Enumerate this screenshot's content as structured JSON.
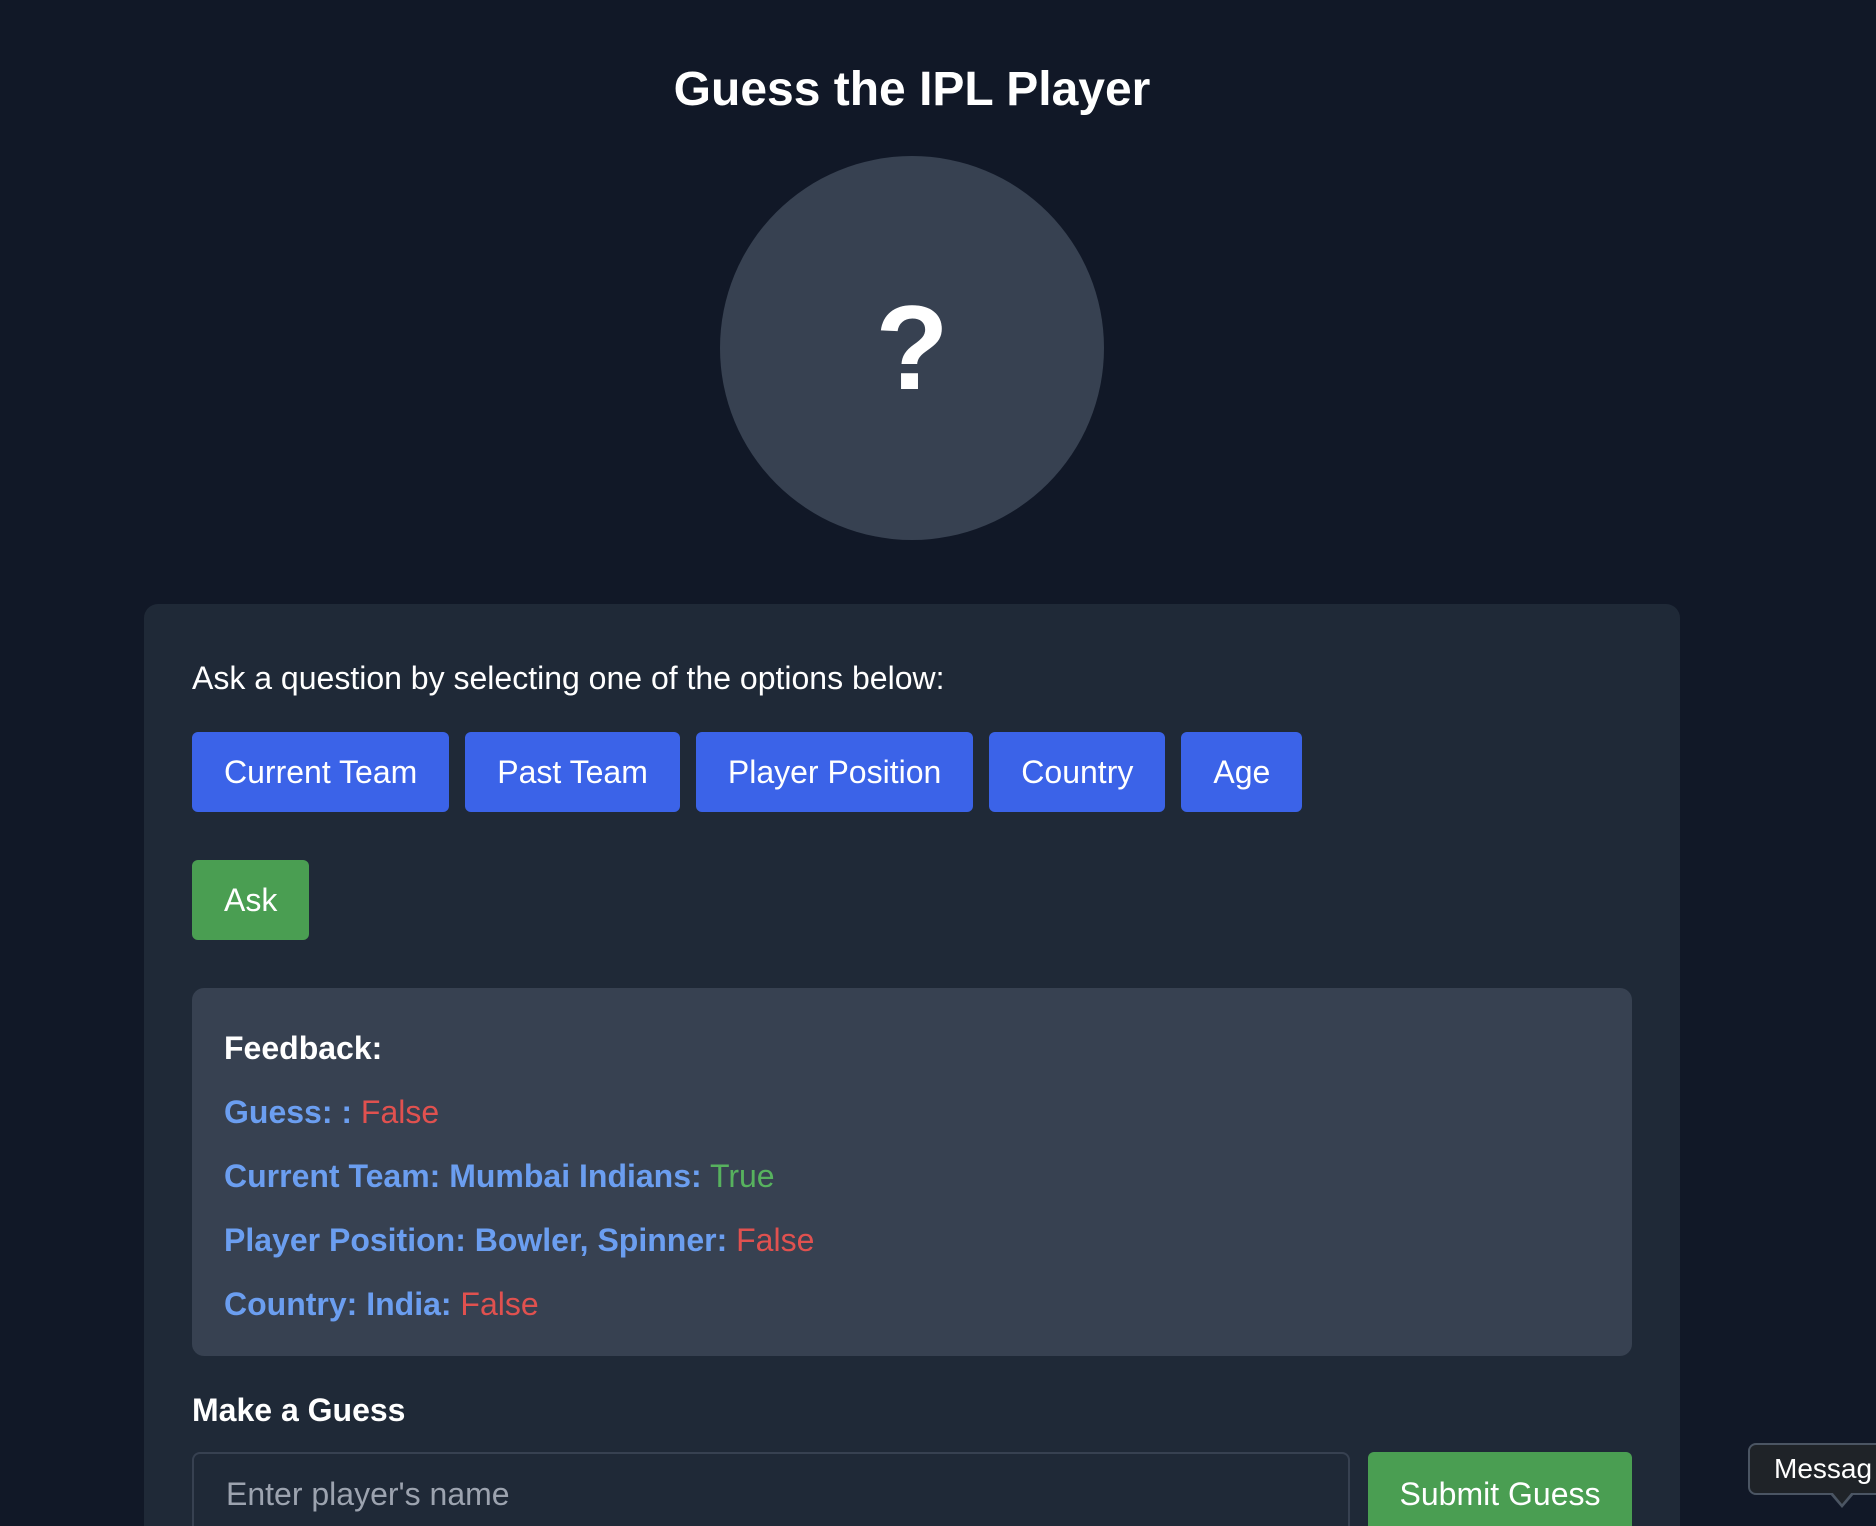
{
  "page": {
    "title": "Guess the IPL Player"
  },
  "avatar": {
    "icon": "question-mark-icon",
    "glyph": "?"
  },
  "question_panel": {
    "prompt": "Ask a question by selecting one of the options below:",
    "options": [
      {
        "label": "Current Team"
      },
      {
        "label": "Past Team"
      },
      {
        "label": "Player Position"
      },
      {
        "label": "Country"
      },
      {
        "label": "Age"
      }
    ],
    "ask_label": "Ask"
  },
  "feedback": {
    "title": "Feedback:",
    "entries": [
      {
        "label": "Guess: :",
        "result": "False"
      },
      {
        "label": "Current Team: Mumbai Indians:",
        "result": "True"
      },
      {
        "label": "Player Position: Bowler, Spinner:",
        "result": "False"
      },
      {
        "label": "Country: India:",
        "result": "False"
      }
    ]
  },
  "guess": {
    "title": "Make a Guess",
    "input_value": "",
    "placeholder": "Enter player's name",
    "submit_label": "Submit Guess"
  },
  "tooltip": {
    "text": "Messag"
  },
  "colors": {
    "background": "#111827",
    "card": "#1f2937",
    "panel": "#374151",
    "option_button": "#3b63e8",
    "action_button": "#4a9e52",
    "label_blue": "#6b9ef0",
    "true_green": "#57b25e",
    "false_red": "#e0514f"
  }
}
